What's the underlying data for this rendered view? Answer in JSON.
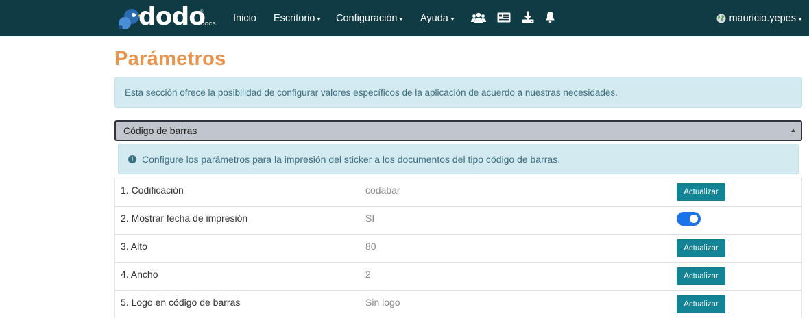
{
  "navbar": {
    "logo_text": "dodo",
    "logo_subtext": "DOCS",
    "logo_reg": "®",
    "items": [
      {
        "label": "Inicio",
        "dropdown": false
      },
      {
        "label": "Escritorio",
        "dropdown": true
      },
      {
        "label": "Configuración",
        "dropdown": true
      },
      {
        "label": "Ayuda",
        "dropdown": true
      }
    ],
    "icons": [
      "users-icon",
      "id-card-icon",
      "download-icon",
      "bell-icon"
    ],
    "user": {
      "name": "mauricio.yepes",
      "icon": "globe-avatar-icon"
    }
  },
  "page": {
    "title": "Parámetros",
    "intro": "Esta sección ofrece la posibilidad de configurar valores específicos de la aplicación de acuerdo a nuestras necesidades."
  },
  "section": {
    "title": "Código de barras",
    "info": "Configure los parámetros para la impresión del sticker a los documentos del tipo código de barras.",
    "update_label": "Actualizar",
    "params": [
      {
        "label": "1. Codificación",
        "value": "codabar",
        "control": "button"
      },
      {
        "label": "2. Mostrar fecha de impresión",
        "value": "SI",
        "control": "toggle",
        "toggle_on": true
      },
      {
        "label": "3. Alto",
        "value": "80",
        "control": "button"
      },
      {
        "label": "4. Ancho",
        "value": "2",
        "control": "button"
      },
      {
        "label": "5. Logo en código de barras",
        "value": "Sin logo",
        "control": "button"
      }
    ]
  },
  "colors": {
    "navbar": "#0f3b44",
    "title": "#e8944c",
    "alert_bg": "#d4eaf1",
    "alert_text": "#3a6f82",
    "button": "#138496",
    "toggle": "#1a73e8"
  }
}
